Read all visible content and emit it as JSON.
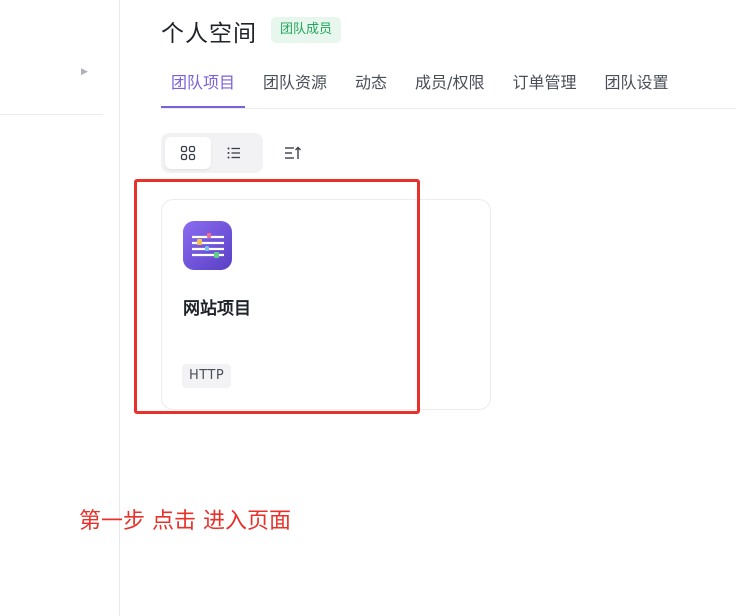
{
  "header": {
    "title": "个人空间",
    "role_badge": "团队成员"
  },
  "tabs": [
    {
      "label": "团队项目",
      "active": true
    },
    {
      "label": "团队资源",
      "active": false
    },
    {
      "label": "动态",
      "active": false
    },
    {
      "label": "成员/权限",
      "active": false
    },
    {
      "label": "订单管理",
      "active": false
    },
    {
      "label": "团队设置",
      "active": false
    }
  ],
  "toolbar": {
    "view_mode_selected": "grid",
    "icons": [
      "grid-view-icon",
      "list-view-icon",
      "sort-icon"
    ]
  },
  "projects": [
    {
      "name": "网站项目",
      "protocol": "HTTP",
      "icon": "api-doc-icon"
    }
  ],
  "annotation": {
    "text": "第一步 点击 进入页面",
    "color": "#e8312a"
  },
  "colors": {
    "accent": "#7b61d8",
    "badge_text": "#23a55a",
    "badge_bg": "#e7f7ee",
    "highlight": "#e8312a"
  }
}
